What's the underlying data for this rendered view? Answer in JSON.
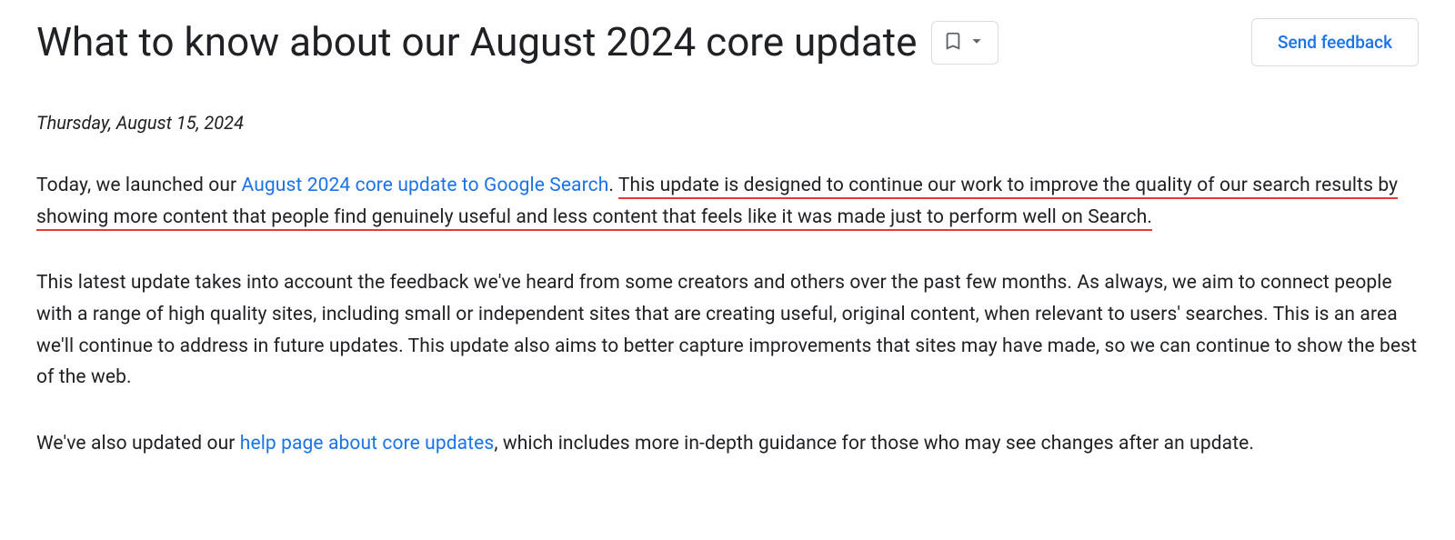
{
  "header": {
    "title": "What to know about our August 2024 core update",
    "feedback_label": "Send feedback"
  },
  "date": "Thursday, August 15, 2024",
  "para1": {
    "lead": "Today, we launched our ",
    "link_text": "August 2024 core update to Google Search",
    "after_link": ". ",
    "underlined_text": "This update is designed to continue our work to improve the quality of our search results by showing more content that people find genuinely useful and less content that feels like it was made just to perform well on Search."
  },
  "para2": "This latest update takes into account the feedback we've heard from some creators and others over the past few months. As always, we aim to connect people with a range of high quality sites, including small or independent sites that are creating useful, original content, when relevant to users' searches. This is an area we'll continue to address in future updates. This update also aims to better capture improvements that sites may have made, so we can continue to show the best of the web.",
  "para3": {
    "before": "We've also updated our ",
    "link_text": "help page about core updates",
    "after": ", which includes more in-depth guidance for those who may see changes after an update."
  }
}
